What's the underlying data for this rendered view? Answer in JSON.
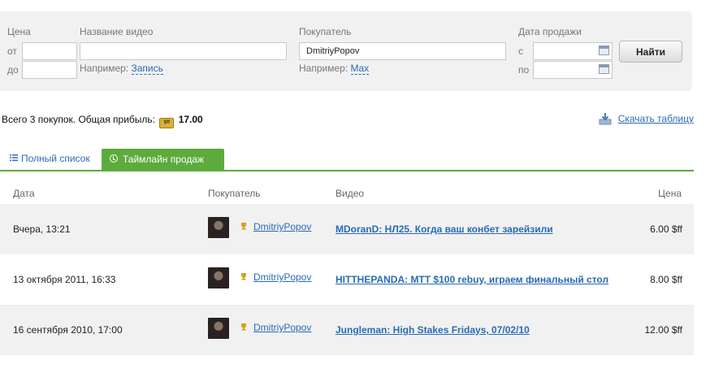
{
  "filters": {
    "price": {
      "label": "Цена",
      "from_label": "от",
      "to_label": "до",
      "from_value": "",
      "to_value": ""
    },
    "video_name": {
      "label": "Название видео",
      "value": "",
      "hint_prefix": "Например:",
      "hint_link": "Запись"
    },
    "buyer": {
      "label": "Покупатель",
      "value": "DmitriyPopov",
      "hint_prefix": "Например:",
      "hint_link": "Max"
    },
    "sale_date": {
      "label": "Дата продажи",
      "from_label": "с",
      "to_label": "по",
      "from_value": "",
      "to_value": ""
    },
    "search_button": "Найти"
  },
  "summary": {
    "text": "Всего 3 покупок. Общая прибыль:",
    "coin_text": "$ff",
    "total": "17.00"
  },
  "download_link": "Скачать таблицу",
  "tabs": [
    {
      "label": "Полный список",
      "active": false
    },
    {
      "label": "Таймлайн продаж",
      "active": true
    }
  ],
  "table": {
    "headers": {
      "date": "Дата",
      "buyer": "Покупатель",
      "video": "Видео",
      "price": "Цена"
    },
    "rows": [
      {
        "date": "Вчера, 13:21",
        "buyer": "DmitriyPopov",
        "video": "MDoranD: НЛ25. Когда ваш конбет зарейзили",
        "price": "6.00 $ff"
      },
      {
        "date": "13 октября 2011, 16:33",
        "buyer": "DmitriyPopov",
        "video": "HITTHEPANDA: MTT $100 rebuy, играем финальный стол",
        "price": "8.00 $ff"
      },
      {
        "date": "16 сентября 2010, 17:00",
        "buyer": "DmitriyPopov",
        "video": "Jungleman: High Stakes Fridays, 07/02/10",
        "price": "12.00 $ff"
      }
    ]
  },
  "colors": {
    "accent_green": "#5cab3c",
    "link_blue": "#2a6bb5",
    "panel_gray": "#f1f1f1"
  }
}
